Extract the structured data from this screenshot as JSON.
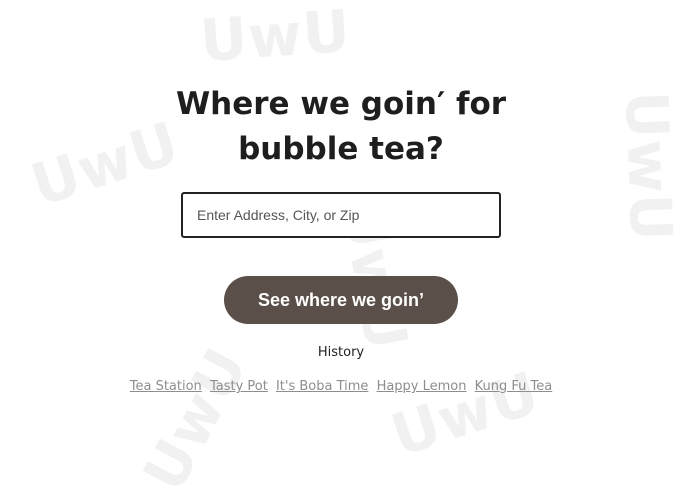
{
  "watermark": {
    "text": "UwU",
    "color": "#f1f1f1"
  },
  "headline": {
    "line1": "Where we goin′ for",
    "line2": "bubble tea?"
  },
  "search": {
    "placeholder": "Enter Address, City, or Zip",
    "value": ""
  },
  "submit_button": {
    "label": "See where we goin’",
    "color": "#5b4f49"
  },
  "history": {
    "label": "History",
    "items": [
      {
        "label": "Tea Station"
      },
      {
        "label": "Tasty Pot"
      },
      {
        "label": "It's Boba Time"
      },
      {
        "label": "Happy Lemon"
      },
      {
        "label": "Kung Fu Tea"
      }
    ]
  }
}
